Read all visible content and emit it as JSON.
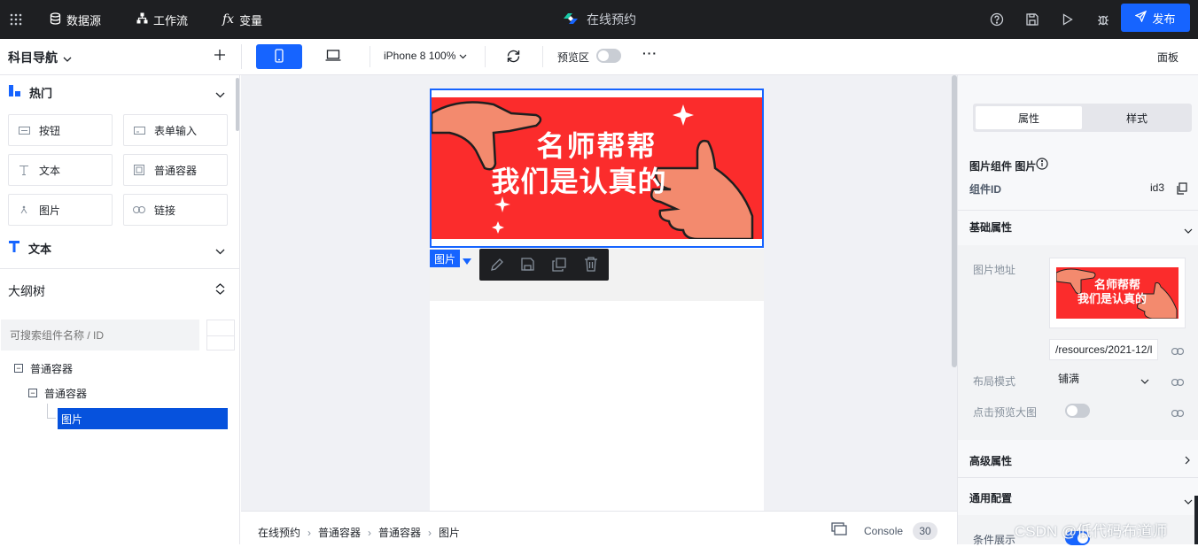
{
  "topbar": {
    "datasource": "数据源",
    "workflow": "工作流",
    "variables": "变量",
    "fx": "fx",
    "app_title": "在线预约",
    "publish": "发布"
  },
  "toolbar": {
    "nav_title": "科目导航",
    "device_label": "iPhone 8 100%",
    "preview_label": "预览区",
    "more": "···",
    "panel": "面板"
  },
  "components": {
    "hot_title": "热门",
    "items": [
      {
        "label": "按钮"
      },
      {
        "label": "表单输入"
      },
      {
        "label": "文本"
      },
      {
        "label": "普通容器"
      },
      {
        "label": "图片"
      },
      {
        "label": "链接"
      }
    ],
    "text_title": "文本"
  },
  "outline": {
    "title": "大纲树",
    "search_placeholder": "可搜索组件名称 / ID",
    "nodes": [
      {
        "label": "普通容器"
      },
      {
        "label": "普通容器"
      },
      {
        "label": "图片"
      }
    ]
  },
  "canvas": {
    "banner_line1": "名师帮帮",
    "banner_line2": "我们是认真的",
    "selected_tag": "图片",
    "banner_bg": "#fb2c2c"
  },
  "breadcrumb": {
    "items": [
      "在线预约",
      "普通容器",
      "普通容器",
      "图片"
    ],
    "console": "Console",
    "console_count": "30"
  },
  "props": {
    "tabs": [
      "属性",
      "样式"
    ],
    "component_title": "图片组件 图片",
    "id_label": "组件ID",
    "id_value": "id3",
    "basic_title": "基础属性",
    "image_url_label": "图片地址",
    "image_url_value": "/resources/2021-12/l",
    "layout_label": "布局模式",
    "layout_value": "铺满",
    "preview_label": "点击预览大图",
    "advanced_title": "高级属性",
    "general_title": "通用配置",
    "conditional_label": "条件展示"
  },
  "watermark": "CSDN @低代码布道师",
  "colors": {
    "accent": "#1664ff",
    "topbar": "#1e1f22"
  }
}
